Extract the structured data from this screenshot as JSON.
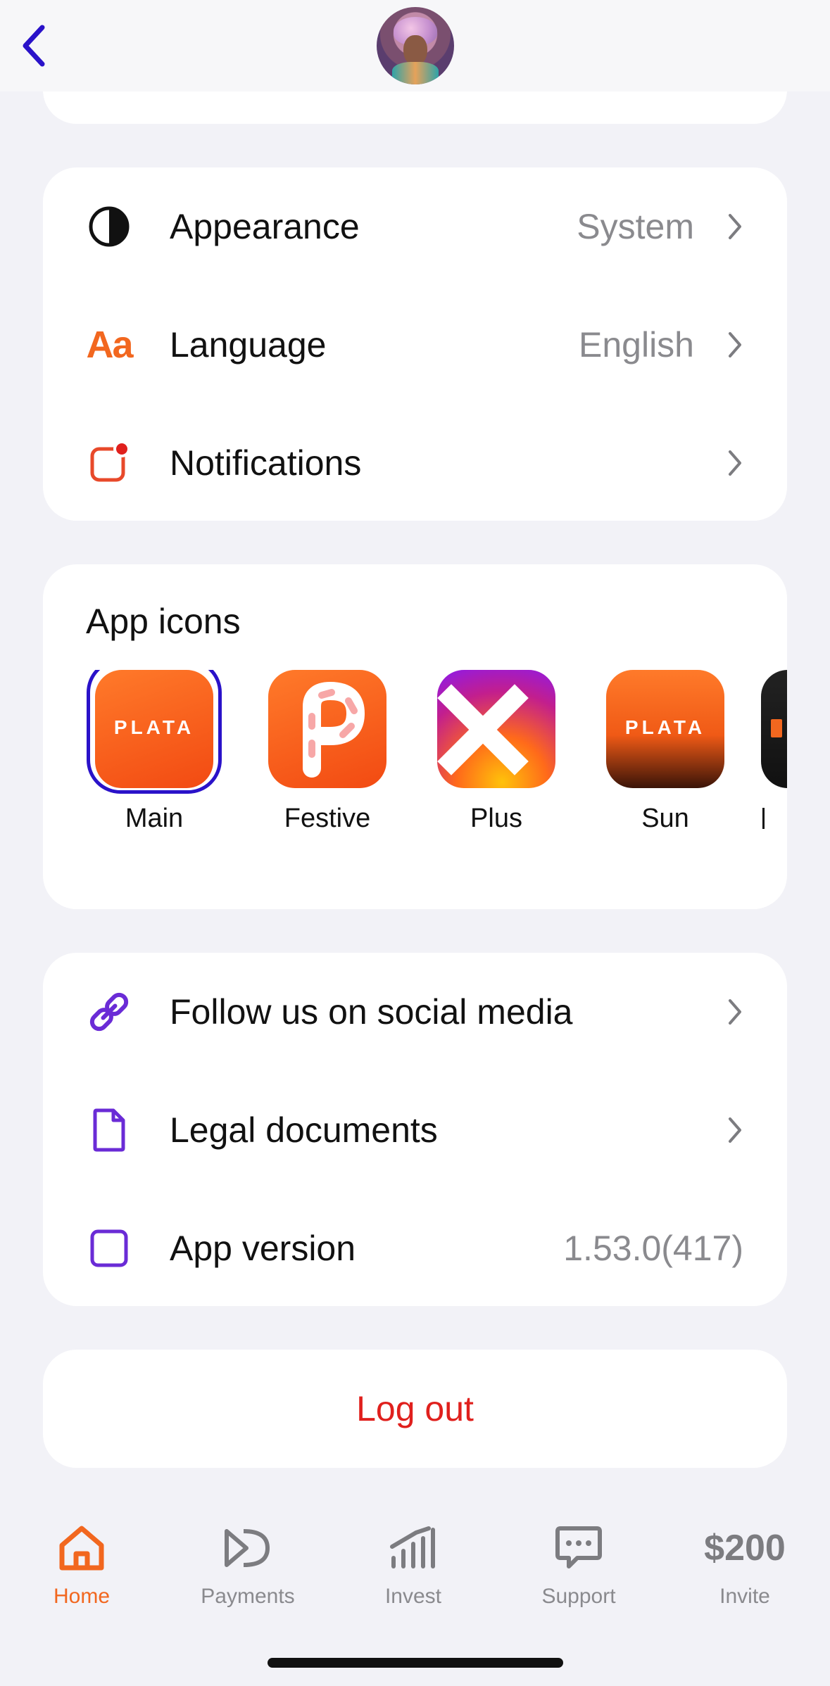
{
  "settings": {
    "appearance": {
      "label": "Appearance",
      "value": "System"
    },
    "language": {
      "label": "Language",
      "value": "English",
      "icon_text": "Aa"
    },
    "notifications": {
      "label": "Notifications"
    }
  },
  "app_icons": {
    "title": "App icons",
    "items": [
      {
        "label": "Main",
        "brand_text": "PLATA",
        "selected": true
      },
      {
        "label": "Festive"
      },
      {
        "label": "Plus"
      },
      {
        "label": "Sun",
        "brand_text": "PLATA"
      }
    ]
  },
  "info": {
    "social": {
      "label": "Follow us on social media"
    },
    "legal": {
      "label": "Legal documents"
    },
    "version": {
      "label": "App version",
      "value": "1.53.0(417)"
    }
  },
  "logout": {
    "label": "Log out"
  },
  "tabbar": {
    "home": "Home",
    "payments": "Payments",
    "invest": "Invest",
    "support": "Support",
    "invite": "Invite",
    "invite_amount": "$200"
  },
  "colors": {
    "accent_orange": "#F2671F",
    "accent_purple": "#6A2BD6",
    "selected_ring": "#2A12C9",
    "danger": "#E0201D",
    "back_arrow": "#2A12C9"
  }
}
